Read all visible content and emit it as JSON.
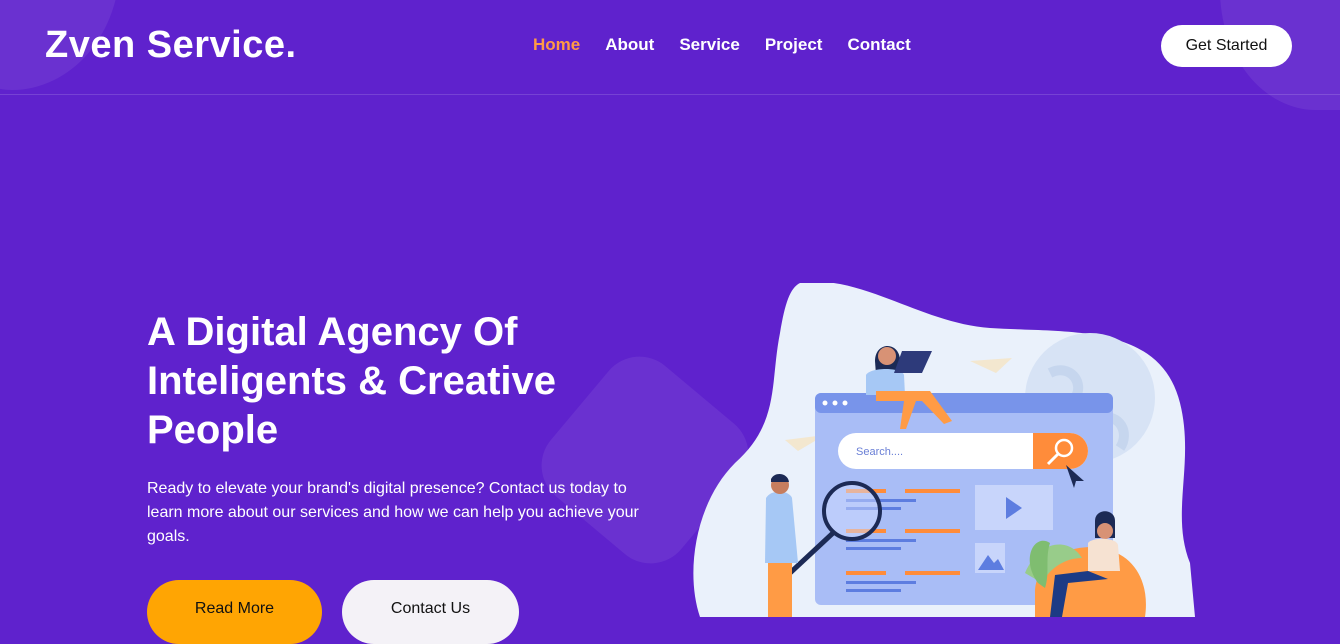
{
  "header": {
    "logo": "Zven Service.",
    "nav": [
      {
        "label": "Home",
        "active": true
      },
      {
        "label": "About"
      },
      {
        "label": "Service"
      },
      {
        "label": "Project"
      },
      {
        "label": "Contact"
      }
    ],
    "cta_label": "Get Started"
  },
  "hero": {
    "title_line1": "A Digital Agency Of",
    "title_line2": "Inteligents & Creative",
    "title_line3": "People",
    "description": "Ready to elevate your brand's digital presence? Contact us today to learn more about our services and how we can help you achieve your goals.",
    "read_more_label": "Read More",
    "contact_label": "Contact Us"
  },
  "illustration": {
    "search_placeholder": "Search....",
    "accent": "#ff8c3a"
  },
  "colors": {
    "background": "#5f22cd",
    "active_nav": "#ff9a45",
    "primary_button": "#ffa503"
  }
}
